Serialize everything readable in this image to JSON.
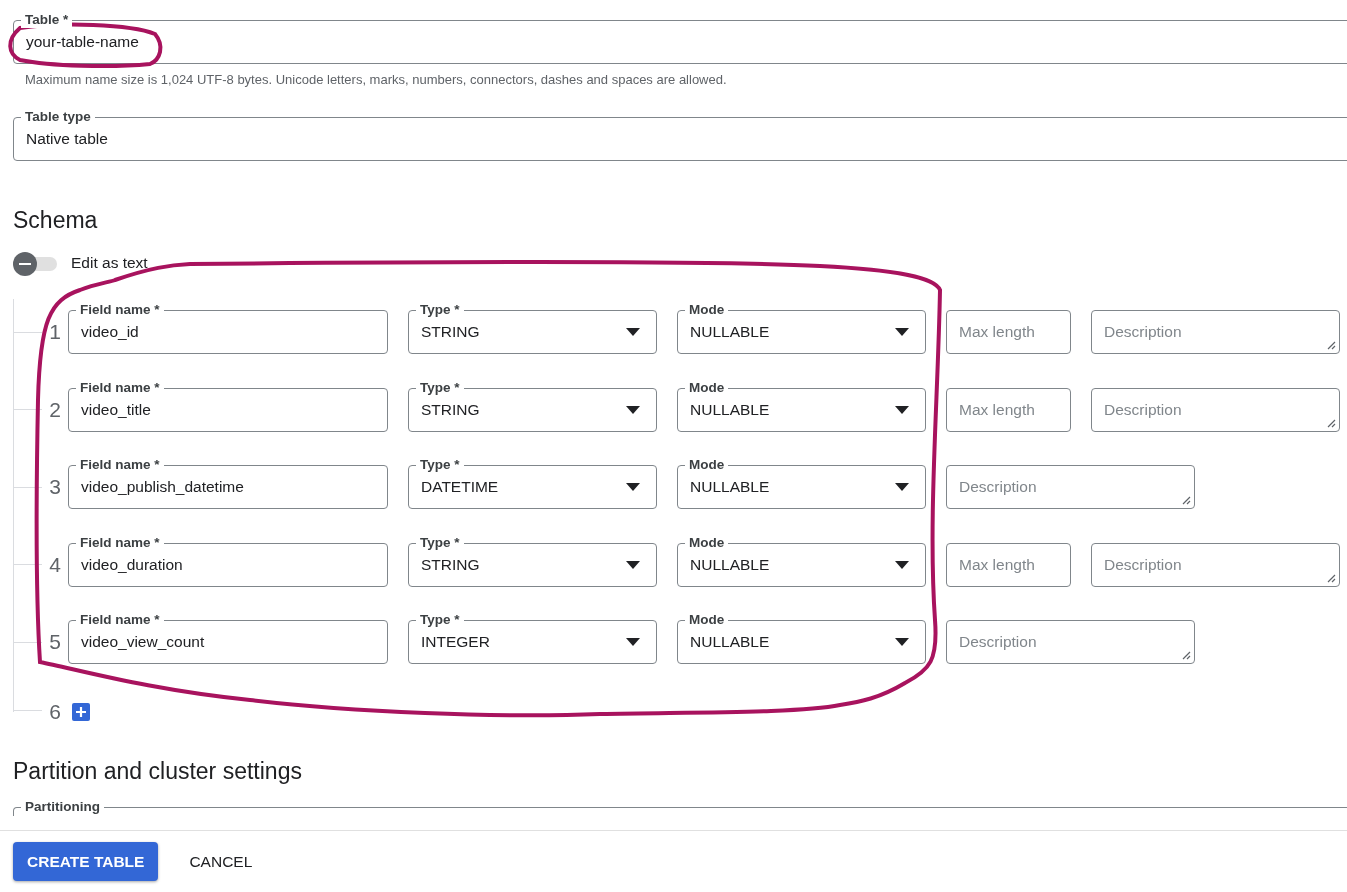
{
  "table_name": {
    "label": "Table *",
    "value": "your-table-name",
    "hint": "Maximum name size is 1,024 UTF-8 bytes. Unicode letters, marks, numbers, connectors, dashes and spaces are allowed."
  },
  "table_type": {
    "label": "Table type",
    "value": "Native table"
  },
  "schema": {
    "heading": "Schema",
    "edit_as_text": {
      "label": "Edit as text",
      "on": false
    },
    "fields": [
      {
        "number": "1",
        "name": {
          "label": "Field name *",
          "value": "video_id"
        },
        "type": {
          "label": "Type *",
          "value": "STRING"
        },
        "mode": {
          "label": "Mode",
          "value": "NULLABLE"
        },
        "max_length": {
          "placeholder": "Max length"
        },
        "description": {
          "placeholder": "Description"
        }
      },
      {
        "number": "2",
        "name": {
          "label": "Field name *",
          "value": "video_title"
        },
        "type": {
          "label": "Type *",
          "value": "STRING"
        },
        "mode": {
          "label": "Mode",
          "value": "NULLABLE"
        },
        "max_length": {
          "placeholder": "Max length"
        },
        "description": {
          "placeholder": "Description"
        }
      },
      {
        "number": "3",
        "name": {
          "label": "Field name *",
          "value": "video_publish_datetime"
        },
        "type": {
          "label": "Type *",
          "value": "DATETIME"
        },
        "mode": {
          "label": "Mode",
          "value": "NULLABLE"
        },
        "description": {
          "placeholder": "Description"
        }
      },
      {
        "number": "4",
        "name": {
          "label": "Field name *",
          "value": "video_duration"
        },
        "type": {
          "label": "Type *",
          "value": "STRING"
        },
        "mode": {
          "label": "Mode",
          "value": "NULLABLE"
        },
        "max_length": {
          "placeholder": "Max length"
        },
        "description": {
          "placeholder": "Description"
        }
      },
      {
        "number": "5",
        "name": {
          "label": "Field name *",
          "value": "video_view_count"
        },
        "type": {
          "label": "Type *",
          "value": "INTEGER"
        },
        "mode": {
          "label": "Mode",
          "value": "NULLABLE"
        },
        "description": {
          "placeholder": "Description"
        }
      }
    ],
    "next_number": "6"
  },
  "partition": {
    "heading": "Partition and cluster settings",
    "partitioning": {
      "label": "Partitioning"
    }
  },
  "buttons": [
    {
      "label": "CREATE TABLE",
      "kind": "primary"
    },
    {
      "label": "CANCEL",
      "kind": "text"
    }
  ]
}
